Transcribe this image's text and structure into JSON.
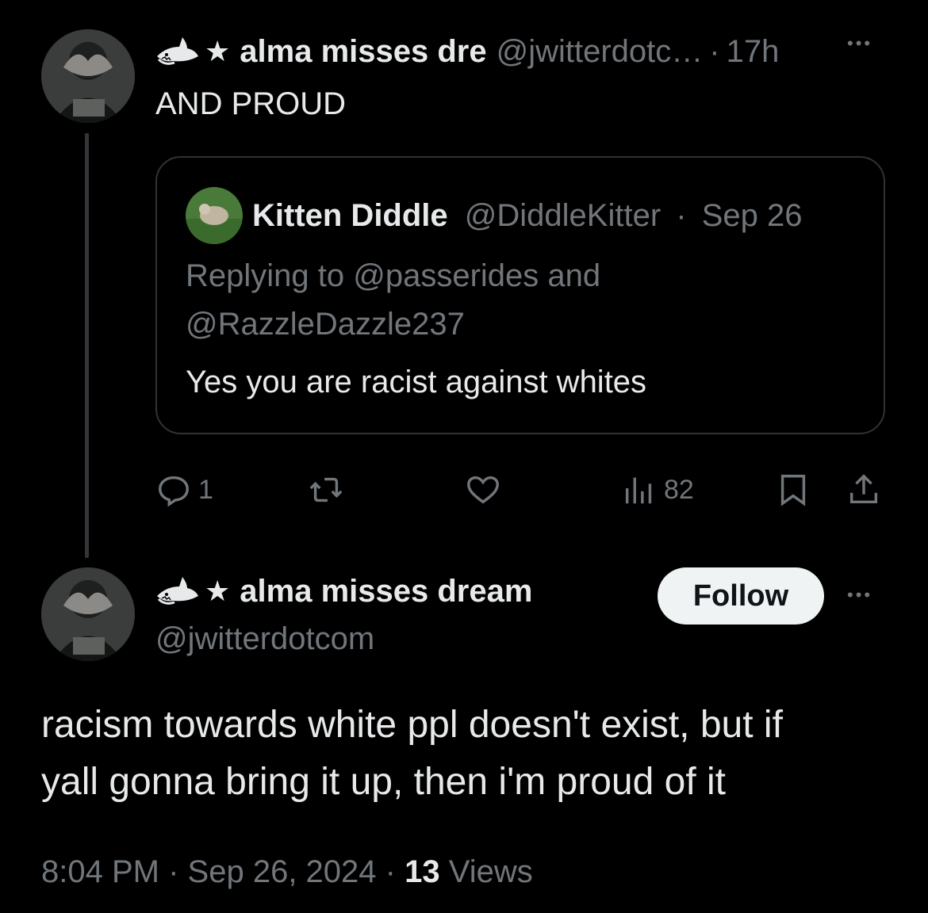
{
  "reply_tweet": {
    "display_name": "alma misses dre",
    "handle": "@jwitterdotc…",
    "separator": "·",
    "time": "17h",
    "more": "•••",
    "text": "AND PROUD",
    "quote": {
      "display_name": "Kitten Diddle",
      "handle": "@DiddleKitter",
      "separator": "·",
      "date": "Sep 26",
      "replying_line1": "Replying to @passerides and",
      "replying_line2": "@RazzleDazzle237",
      "text": "Yes you are racist against whites"
    },
    "actions": {
      "replies": "1",
      "retweets": "",
      "likes": "",
      "views": "82"
    }
  },
  "main_tweet": {
    "display_name": "alma misses dream",
    "handle": "@jwitterdotcom",
    "follow_label": "Follow",
    "more": "•••",
    "text_line1": "racism towards white ppl doesn't exist, but if",
    "text_line2": "yall gonna bring it up, then i'm proud of it",
    "time": "8:04 PM",
    "sep1": "·",
    "date": "Sep 26, 2024",
    "sep2": "·",
    "views_count": "13",
    "views_label": "Views"
  },
  "colors": {
    "background": "#000000",
    "text": "#e7e9ea",
    "secondary": "#71767b",
    "border": "#2f3336",
    "follow_bg": "#eff3f4"
  }
}
